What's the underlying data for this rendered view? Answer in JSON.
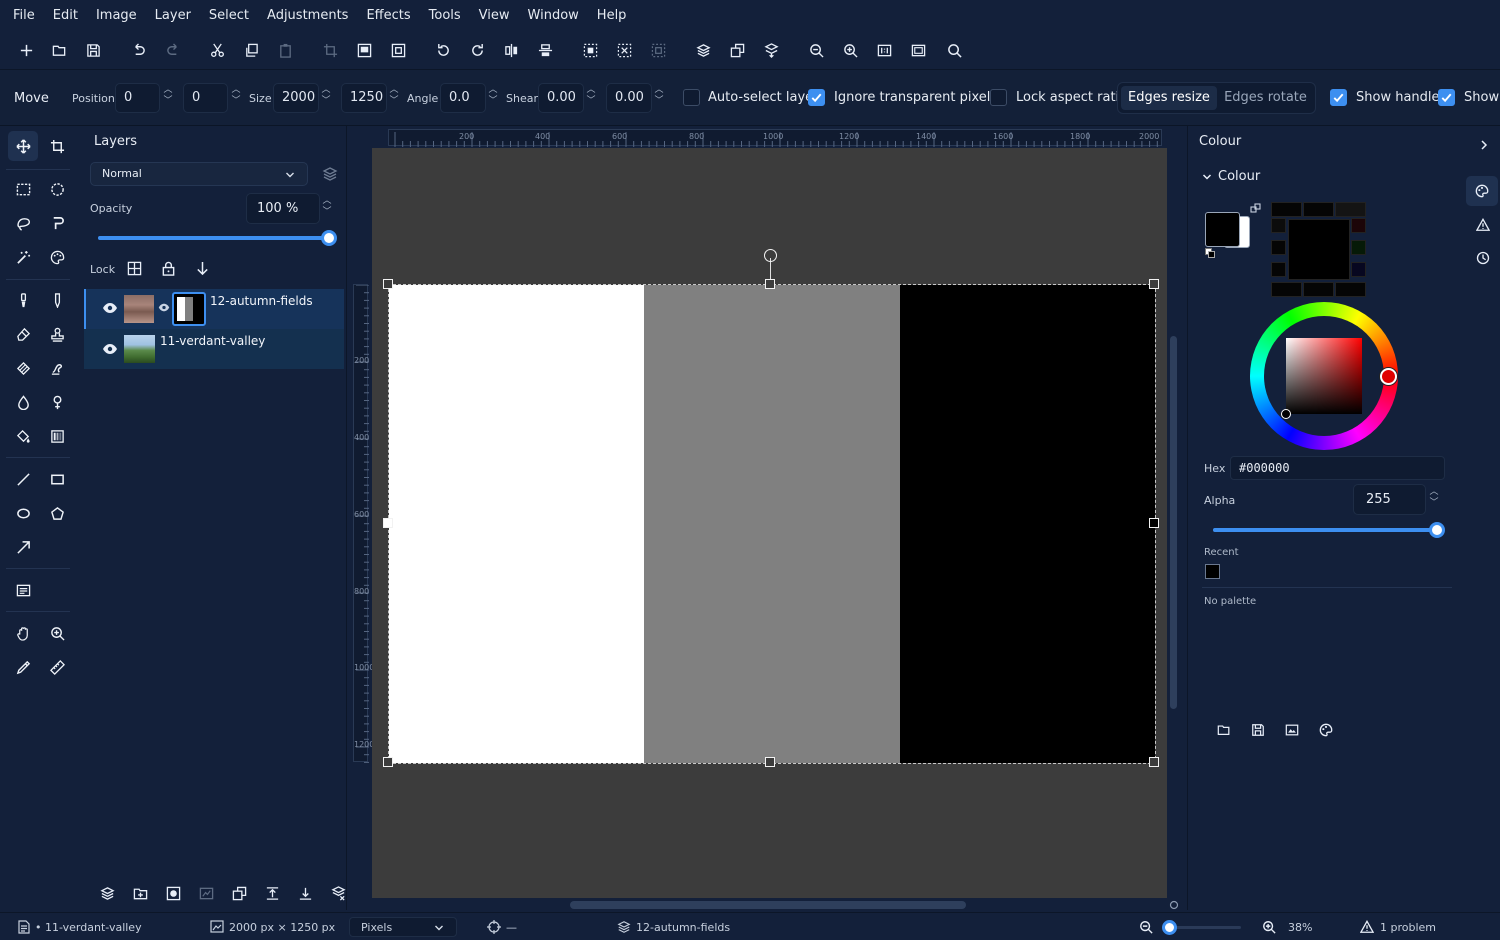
{
  "menu": [
    "File",
    "Edit",
    "Image",
    "Layer",
    "Select",
    "Adjustments",
    "Effects",
    "Tools",
    "View",
    "Window",
    "Help"
  ],
  "toolbar_icons": [
    "new-icon",
    "open-icon",
    "save-icon",
    "undo-icon",
    "redo-icon",
    "cut-icon",
    "copy-icon",
    "paste-icon",
    "crop-icon",
    "resize-image-icon",
    "resize-canvas-icon",
    "rotate-left-icon",
    "rotate-right-icon",
    "flip-horizontal-icon",
    "flip-vertical-icon",
    "select-all-icon",
    "deselect-icon",
    "invert-selection-icon",
    "flatten-icon",
    "duplicate-layer-icon",
    "merge-down-icon",
    "zoom-out-icon",
    "zoom-in-icon",
    "actual-size-icon",
    "best-fit-icon",
    "search-icon"
  ],
  "options": {
    "tool_name": "Move",
    "position_label": "Position",
    "position_x": "0",
    "position_y": "0",
    "size_label": "Size",
    "size_w": "2000",
    "size_h": "1250",
    "angle_label": "Angle",
    "angle": "0.0",
    "shear_label": "Shear",
    "shear_x": "0.00",
    "shear_y": "0.00",
    "auto_select": {
      "label": "Auto-select layer",
      "checked": false
    },
    "ignore_transparent": {
      "label": "Ignore transparent pixels",
      "checked": true
    },
    "lock_aspect": {
      "label": "Lock aspect ratio",
      "checked": false
    },
    "edges_resize": "Edges resize",
    "edges_rotate": "Edges rotate",
    "show_handles": {
      "label": "Show handles",
      "checked": true
    },
    "show_more": {
      "label": "Show",
      "checked": true
    }
  },
  "layers_panel": {
    "title": "Layers",
    "blend_mode": "Normal",
    "opacity_label": "Opacity",
    "opacity_value": "100 %",
    "opacity_fraction": 1.0,
    "lock_label": "Lock",
    "layers": [
      {
        "name": "12-autumn-fields",
        "selected": true,
        "has_mask": true
      },
      {
        "name": "11-verdant-valley",
        "selected": false,
        "has_mask": false
      }
    ]
  },
  "rulers": {
    "horizontal": [
      "200",
      "400",
      "600",
      "800",
      "1000",
      "1200",
      "1400",
      "1600",
      "1800",
      "2000"
    ],
    "vertical": [
      "200",
      "400",
      "600",
      "800",
      "1000",
      "1200"
    ]
  },
  "canvas_image": {
    "stripes": [
      "#ffffff",
      "#808080",
      "#000000"
    ]
  },
  "colour_panel": {
    "header": "Colour",
    "section": "Colour",
    "primary_color": "#000000",
    "secondary_color": "#ffffff",
    "hex_label": "Hex",
    "hex_value": "#000000",
    "alpha_label": "Alpha",
    "alpha_value": "255",
    "alpha_fraction": 1.0,
    "recent_label": "Recent",
    "recent_colors": [
      "#000000"
    ],
    "palette_label": "No palette"
  },
  "status": {
    "document": "• 11-verdant-valley",
    "image_size": "2000 px × 1250 px",
    "units": "Pixels",
    "cursor": "—",
    "layer": "12-autumn-fields",
    "zoom": "38%",
    "problems": "1 problem"
  }
}
